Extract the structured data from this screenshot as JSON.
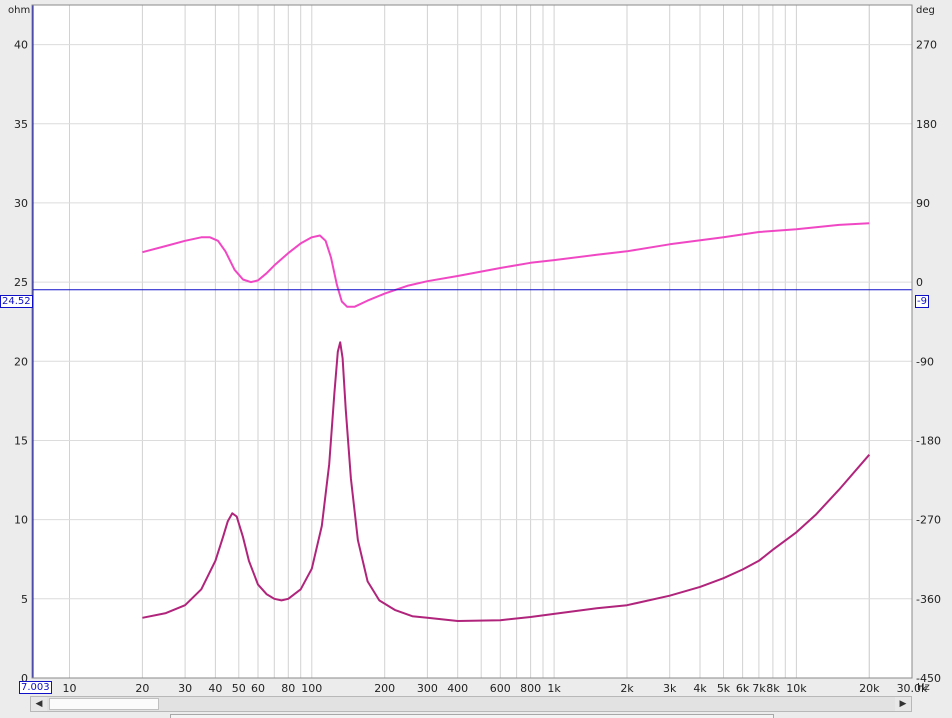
{
  "chart_data": {
    "type": "line",
    "x_scale": "log",
    "x_unit": "Hz",
    "x_range": [
      7.003,
      30000
    ],
    "x_ticks": [
      {
        "value": 10,
        "label": "10"
      },
      {
        "value": 20,
        "label": "20"
      },
      {
        "value": 30,
        "label": "30"
      },
      {
        "value": 40,
        "label": "40"
      },
      {
        "value": 50,
        "label": "50"
      },
      {
        "value": 60,
        "label": "60"
      },
      {
        "value": 80,
        "label": "80"
      },
      {
        "value": 100,
        "label": "100"
      },
      {
        "value": 200,
        "label": "200"
      },
      {
        "value": 300,
        "label": "300"
      },
      {
        "value": 400,
        "label": "400"
      },
      {
        "value": 600,
        "label": "600"
      },
      {
        "value": 800,
        "label": "800"
      },
      {
        "value": 1000,
        "label": "1k"
      },
      {
        "value": 2000,
        "label": "2k"
      },
      {
        "value": 3000,
        "label": "3k"
      },
      {
        "value": 4000,
        "label": "4k"
      },
      {
        "value": 5000,
        "label": "5k"
      },
      {
        "value": 6000,
        "label": "6k"
      },
      {
        "value": 7000,
        "label": "7k"
      },
      {
        "value": 8000,
        "label": "8k"
      },
      {
        "value": 10000,
        "label": "10k"
      },
      {
        "value": 20000,
        "label": "20k"
      },
      {
        "value": 30000,
        "label": "30.0k"
      }
    ],
    "y_left": {
      "unit": "ohm",
      "range": [
        0,
        42.5
      ],
      "ticks": [
        0,
        5,
        10,
        15,
        20,
        25,
        30,
        35,
        40
      ]
    },
    "y_right": {
      "unit": "deg",
      "range": [
        -450,
        315
      ],
      "ticks": [
        270,
        180,
        90,
        0,
        -90,
        -180,
        -270,
        -360,
        -450
      ]
    },
    "cursor": {
      "y_readout": "24.52",
      "phase_readout": "-9",
      "x_readout": "7.003"
    },
    "grid": true,
    "series": [
      {
        "axis": "left",
        "color": "#b0247c",
        "points": [
          [
            20,
            3.8
          ],
          [
            25,
            4.1
          ],
          [
            30,
            4.6
          ],
          [
            35,
            5.6
          ],
          [
            40,
            7.4
          ],
          [
            43,
            8.9
          ],
          [
            45,
            9.9
          ],
          [
            47,
            10.4
          ],
          [
            49,
            10.2
          ],
          [
            52,
            8.9
          ],
          [
            55,
            7.4
          ],
          [
            60,
            5.9
          ],
          [
            65,
            5.3
          ],
          [
            70,
            5.0
          ],
          [
            75,
            4.9
          ],
          [
            80,
            5.0
          ],
          [
            90,
            5.6
          ],
          [
            100,
            6.9
          ],
          [
            110,
            9.6
          ],
          [
            118,
            13.5
          ],
          [
            124,
            18.0
          ],
          [
            128,
            20.6
          ],
          [
            131,
            21.2
          ],
          [
            134,
            20.2
          ],
          [
            138,
            17.0
          ],
          [
            145,
            12.6
          ],
          [
            155,
            8.7
          ],
          [
            170,
            6.1
          ],
          [
            190,
            4.9
          ],
          [
            220,
            4.3
          ],
          [
            260,
            3.9
          ],
          [
            300,
            3.8
          ],
          [
            400,
            3.6
          ],
          [
            600,
            3.65
          ],
          [
            800,
            3.85
          ],
          [
            1000,
            4.05
          ],
          [
            1500,
            4.4
          ],
          [
            2000,
            4.6
          ],
          [
            3000,
            5.2
          ],
          [
            4000,
            5.75
          ],
          [
            5000,
            6.3
          ],
          [
            6000,
            6.85
          ],
          [
            7000,
            7.4
          ],
          [
            8000,
            8.1
          ],
          [
            10000,
            9.2
          ],
          [
            12000,
            10.3
          ],
          [
            15000,
            11.9
          ],
          [
            20000,
            14.1
          ]
        ]
      },
      {
        "axis": "right",
        "color": "#f048c4",
        "points": [
          [
            20,
            34
          ],
          [
            25,
            41
          ],
          [
            30,
            47
          ],
          [
            35,
            51
          ],
          [
            38,
            51
          ],
          [
            41,
            47
          ],
          [
            44,
            35
          ],
          [
            48,
            14
          ],
          [
            52,
            3
          ],
          [
            56,
            0
          ],
          [
            60,
            2
          ],
          [
            65,
            10
          ],
          [
            70,
            19
          ],
          [
            80,
            33
          ],
          [
            90,
            44
          ],
          [
            100,
            51
          ],
          [
            108,
            53
          ],
          [
            114,
            47
          ],
          [
            120,
            28
          ],
          [
            127,
            -3
          ],
          [
            133,
            -22
          ],
          [
            140,
            -28
          ],
          [
            150,
            -28
          ],
          [
            170,
            -21
          ],
          [
            200,
            -13
          ],
          [
            250,
            -4
          ],
          [
            300,
            1
          ],
          [
            400,
            7
          ],
          [
            600,
            16
          ],
          [
            800,
            22
          ],
          [
            1000,
            25
          ],
          [
            1500,
            31
          ],
          [
            2000,
            35
          ],
          [
            3000,
            43
          ],
          [
            5000,
            51
          ],
          [
            7000,
            57
          ],
          [
            10000,
            60
          ],
          [
            15000,
            65
          ],
          [
            20000,
            67
          ]
        ]
      }
    ]
  },
  "scrollbar": {
    "left_arrow": "◀",
    "right_arrow": "▶"
  }
}
